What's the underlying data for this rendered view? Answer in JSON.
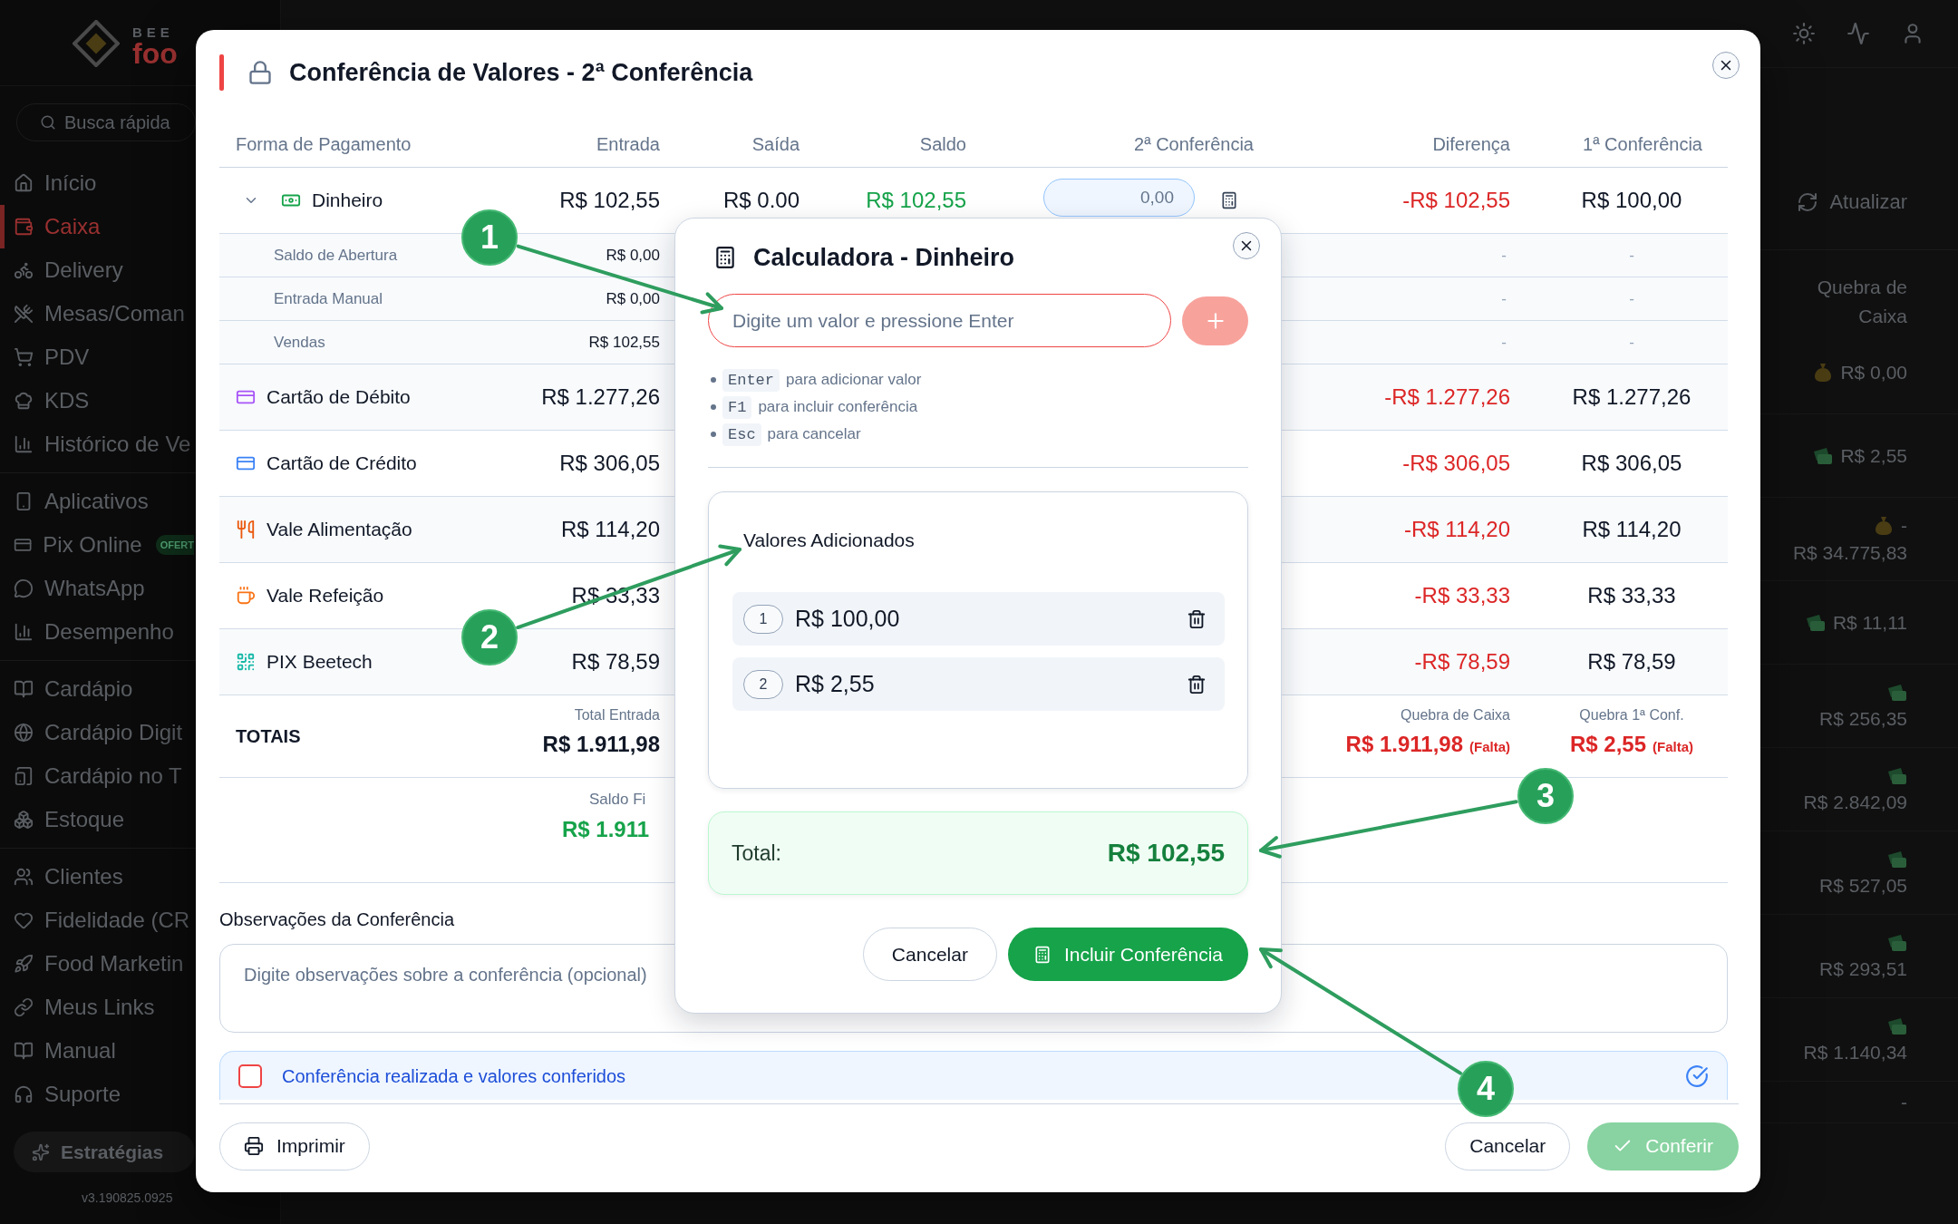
{
  "background_app": {
    "logo": {
      "top": "BEE",
      "bottom": "foo"
    },
    "search": {
      "placeholder": "Busca rápida"
    },
    "sidebar": {
      "sections": [
        {
          "items": [
            {
              "label": "Início",
              "selected": false
            },
            {
              "label": "Caixa",
              "selected": true
            },
            {
              "label": "Delivery",
              "selected": false
            },
            {
              "label": "Mesas/Coman",
              "selected": false
            },
            {
              "label": "PDV",
              "selected": false
            },
            {
              "label": "KDS",
              "selected": false
            },
            {
              "label": "Histórico de Ve",
              "selected": false
            }
          ]
        },
        {
          "items": [
            {
              "label": "Aplicativos",
              "selected": false
            },
            {
              "label": "Pix Online",
              "selected": false,
              "tag": "OFERT"
            },
            {
              "label": "WhatsApp",
              "selected": false
            },
            {
              "label": "Desempenho",
              "selected": false
            }
          ]
        },
        {
          "items": [
            {
              "label": "Cardápio",
              "selected": false
            },
            {
              "label": "Cardápio Digit",
              "selected": false
            },
            {
              "label": "Cardápio no T",
              "selected": false
            },
            {
              "label": "Estoque",
              "selected": false
            }
          ]
        },
        {
          "items": [
            {
              "label": "Clientes",
              "selected": false
            },
            {
              "label": "Fidelidade (CR",
              "selected": false
            },
            {
              "label": "Food Marketin",
              "selected": false
            },
            {
              "label": "Meus Links",
              "selected": false
            },
            {
              "label": "Manual",
              "selected": false
            },
            {
              "label": "Suporte",
              "selected": false
            }
          ]
        }
      ]
    },
    "strategies_button": "Estratégias",
    "version": "v3.190825.0925",
    "refresh_button": "Atualizar",
    "column_header": "Quebra de Caixa",
    "cash_breaks": [
      {
        "kind": "bag",
        "value": "R$ 0,00"
      },
      {
        "kind": "bills",
        "value": "R$ 2,55"
      },
      {
        "kind": "bag_split",
        "sign": "-",
        "value": "R$ 34.775,83"
      },
      {
        "kind": "bills",
        "value": "R$ 11,11"
      },
      {
        "kind": "bills_stacked",
        "value": "R$ 256,35"
      },
      {
        "kind": "bills_stacked",
        "value": "R$ 2.842,09"
      },
      {
        "kind": "bills_stacked",
        "value": "R$ 527,05"
      },
      {
        "kind": "bills_stacked",
        "value": "R$ 293,51"
      },
      {
        "kind": "bills_stacked",
        "value": "R$ 1.140,34"
      },
      {
        "kind": "plain",
        "value": "-"
      }
    ]
  },
  "modal": {
    "title": "Conferência de Valores - 2ª Conferência",
    "table": {
      "columns": [
        "Forma de Pagamento",
        "Entrada",
        "Saída",
        "Saldo",
        "2ª Conferência",
        "Diferença",
        "1ª Conferência"
      ],
      "rows": [
        {
          "kind": "cash",
          "name": "Dinheiro",
          "expanded": true,
          "entrada": "R$ 102,55",
          "saida": "R$ 0.00",
          "saldo": "R$ 102,55",
          "conferencia_2": "0,00",
          "diferenca": "-R$ 102,55",
          "conferencia_1": "R$ 100,00",
          "children": [
            {
              "name": "Saldo de Abertura",
              "entrada": "R$ 0,00",
              "diferenca": "-",
              "conferencia_1": "-"
            },
            {
              "name": "Entrada Manual",
              "entrada": "R$ 0,00",
              "diferenca": "-",
              "conferencia_1": "-"
            },
            {
              "name": "Vendas",
              "entrada": "R$ 102,55",
              "diferenca": "-",
              "conferencia_1": "-"
            }
          ]
        },
        {
          "kind": "debit_card",
          "name": "Cartão de Débito",
          "entrada": "R$ 1.277,26",
          "diferenca": "-R$ 1.277,26",
          "conferencia_1": "R$ 1.277,26"
        },
        {
          "kind": "credit_card",
          "name": "Cartão de Crédito",
          "entrada": "R$ 306,05",
          "diferenca": "-R$ 306,05",
          "conferencia_1": "R$ 306,05"
        },
        {
          "kind": "meal_voucher",
          "name": "Vale Alimentação",
          "entrada": "R$ 114,20",
          "diferenca": "-R$ 114,20",
          "conferencia_1": "R$ 114,20"
        },
        {
          "kind": "food_voucher",
          "name": "Vale Refeição",
          "entrada": "R$ 33,33",
          "diferenca": "-R$ 33,33",
          "conferencia_1": "R$ 33,33"
        },
        {
          "kind": "pix",
          "name": "PIX Beetech",
          "entrada": "R$ 78,59",
          "diferenca": "-R$ 78,59",
          "conferencia_1": "R$ 78,59"
        }
      ],
      "totals": {
        "label": "TOTAIS",
        "entrada": {
          "label": "Total Entrada",
          "value": "R$ 1.911,98"
        },
        "quebra_caixa": {
          "label": "Quebra de Caixa",
          "value": "R$ 1.911,98",
          "note": "(Falta)"
        },
        "quebra_primeira": {
          "label": "Quebra 1ª Conf.",
          "value": "R$ 2,55",
          "note": "(Falta)"
        }
      },
      "final_balance": {
        "label": "Saldo Fi",
        "value": "R$ 1.911"
      }
    },
    "notes": {
      "label": "Observações da Conferência",
      "placeholder": "Digite observações sobre a conferência (opcional)"
    },
    "confirmation": {
      "label": "Conferência realizada e valores conferidos",
      "checked": false
    },
    "footer": {
      "print_button": "Imprimir",
      "cancel_button": "Cancelar",
      "confirm_button": {
        "label": "Conferir",
        "disabled": true
      }
    }
  },
  "calculator": {
    "title": "Calculadora - Dinheiro",
    "input": {
      "placeholder": "Digite um valor e pressione Enter"
    },
    "add_button": {
      "disabled": true
    },
    "hints": [
      {
        "key": "Enter",
        "text": "para adicionar valor"
      },
      {
        "key": "F1",
        "text": "para incluir conferência"
      },
      {
        "key": "Esc",
        "text": "para cancelar"
      }
    ],
    "added": {
      "title": "Valores Adicionados",
      "items": [
        {
          "index": "1",
          "value": "R$ 100,00"
        },
        {
          "index": "2",
          "value": "R$ 2,55"
        }
      ]
    },
    "total": {
      "label": "Total:",
      "value": "R$ 102,55"
    },
    "cancel_button": "Cancelar",
    "include_button": "Incluir Conferência"
  },
  "annotations": [
    {
      "number": "1"
    },
    {
      "number": "2"
    },
    {
      "number": "3"
    },
    {
      "number": "4"
    }
  ]
}
